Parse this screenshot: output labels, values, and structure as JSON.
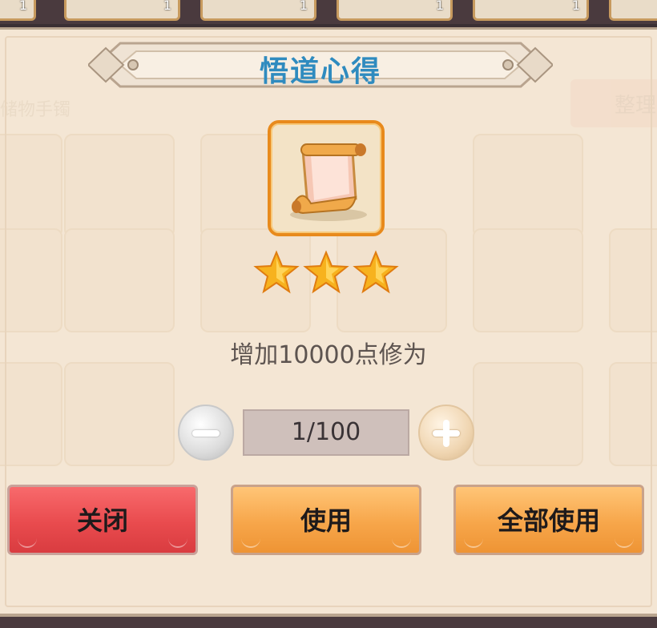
{
  "top_strip": {
    "counts": [
      "1",
      "1",
      "1",
      "1",
      "1"
    ]
  },
  "background": {
    "left_label": "储物手镯",
    "right_button": "整理"
  },
  "dialog": {
    "title": "悟道心得",
    "item_icon": "scroll-icon",
    "stars": 3,
    "description": "增加10000点修为",
    "quantity": "1/100"
  },
  "buttons": {
    "close": "关闭",
    "use": "使用",
    "use_all": "全部使用"
  },
  "colors": {
    "title": "#2f8bbf",
    "close_button": "#e94b4e",
    "use_button": "#f7a64a",
    "item_frame": "#e88a1c",
    "star": "#f5a623"
  }
}
